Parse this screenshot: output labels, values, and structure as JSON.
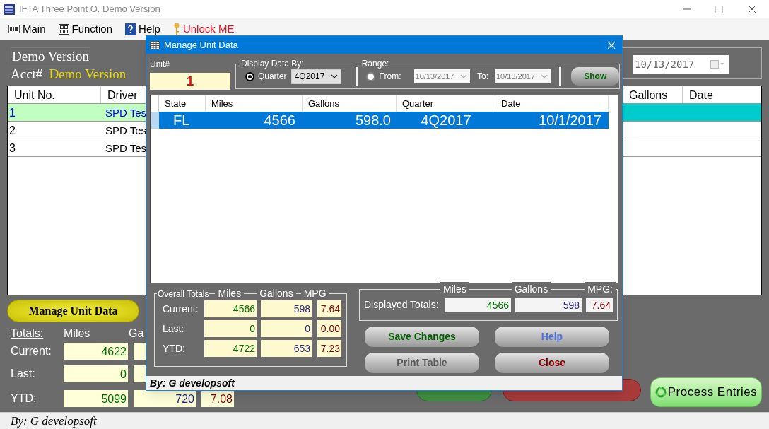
{
  "window": {
    "title": "IFTA Three Point O. Demo Version"
  },
  "menu": [
    {
      "label": "Main",
      "kind": "file"
    },
    {
      "label": "Function",
      "kind": "function"
    },
    {
      "label": "Help",
      "kind": "help"
    },
    {
      "label": "Unlock ME",
      "kind": "unlock"
    }
  ],
  "header": {
    "heading": "Demo Version",
    "acct_label": "Acct#",
    "acct_value": "Demo Version",
    "date": "10/13/2017"
  },
  "units_table": {
    "columns": [
      "Unit No.",
      "Driver",
      "Gallons",
      "Date"
    ],
    "rows": [
      {
        "unit": "1",
        "driver": "SPD Tes",
        "selected": true
      },
      {
        "unit": "2",
        "driver": "SPD Tes",
        "selected": false
      },
      {
        "unit": "3",
        "driver": "SPD Tes",
        "selected": false
      }
    ]
  },
  "manage_button": "Manage Unit Data",
  "totals": {
    "title": "Totals:",
    "columns": [
      "Miles",
      "Ga"
    ],
    "rows": [
      {
        "label": "Current:",
        "values": [
          "4622"
        ]
      },
      {
        "label": "Last:",
        "values": [
          "0"
        ]
      },
      {
        "label": "YTD:",
        "values": [
          "5099",
          "720",
          "7.08"
        ]
      }
    ]
  },
  "action_buttons": [
    {
      "kind": "add"
    },
    {
      "kind": "delete"
    }
  ],
  "process_button": "Process Entries",
  "status_bar": "By: G developsoft",
  "dialog": {
    "title": "Manage Unit Data",
    "unit_label": "Unit#",
    "unit_value": "1",
    "display_group": "Display Data By:",
    "range_group": "Range:",
    "modes": [
      {
        "label": "Quarter",
        "selected": true
      },
      {
        "label": "From:",
        "selected": false
      }
    ],
    "quarter": "4Q2017",
    "from": "10/13/2017",
    "to_label": "To:",
    "to": "10/13/2017",
    "show_button": "Show",
    "table": {
      "columns": [
        "State",
        "Miles",
        "Gallons",
        "Quarter",
        "Date"
      ],
      "rows": [
        {
          "cells": [
            "FL",
            "4566",
            "598.0",
            "4Q2017",
            "10/1/2017"
          ],
          "selected": true
        }
      ]
    },
    "overall": {
      "title": "Overall Totals",
      "columns": [
        "Miles",
        "Gallons",
        "MPG"
      ],
      "rows": [
        {
          "label": "Current:",
          "values": [
            "4566",
            "598",
            "7.64"
          ]
        },
        {
          "label": "Last:",
          "values": [
            "0",
            "0",
            "0.00"
          ]
        },
        {
          "label": "YTD:",
          "values": [
            "4722",
            "653",
            "7.23"
          ]
        }
      ]
    },
    "displayed": {
      "label": "Displayed Totals:",
      "columns": [
        "Miles",
        "Gallons",
        "MPG:"
      ],
      "values": [
        "4566",
        "598",
        "7.64"
      ]
    },
    "buttons": [
      {
        "label": "Save Changes",
        "kind": "save"
      },
      {
        "label": "Help",
        "kind": "help"
      },
      {
        "label": "Print Table",
        "kind": "print"
      },
      {
        "label": "Close",
        "kind": "close"
      }
    ],
    "status_bar": "By: G developsoft"
  }
}
